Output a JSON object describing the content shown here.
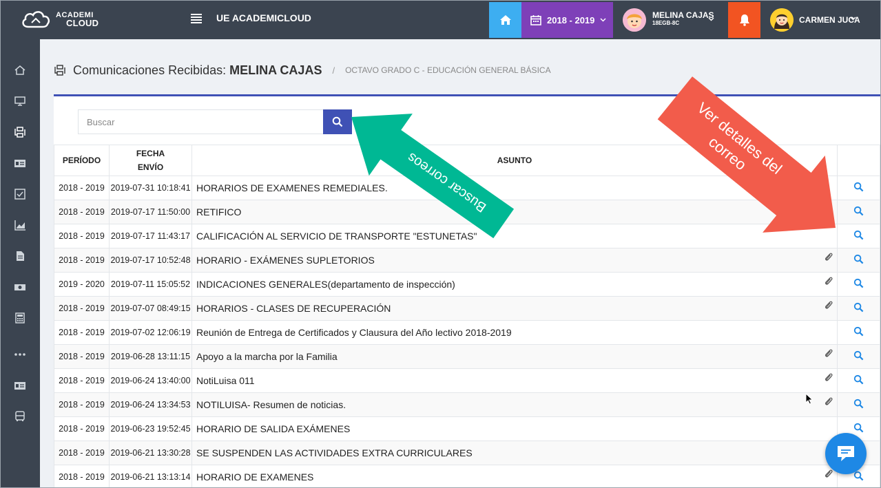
{
  "topbar": {
    "logo_line1": "ACADEMI",
    "logo_line2": "CLOUD",
    "app_title": "UE ACADEMICLOUD",
    "school_year": "2018 - 2019",
    "student_name": "MELINA CAJAS",
    "student_course": "18EGB-8C",
    "user_name": "CARMEN JUCA"
  },
  "colors": {
    "topbar": "#3b4450",
    "home": "#3daef1",
    "year": "#7e40b8",
    "alert": "#f25422",
    "primary": "#3f51b5",
    "annot_green": "#00b894",
    "annot_red": "#f25c4b",
    "link_icon": "#1e88e5"
  },
  "sidebar": {
    "icons": [
      "home-icon",
      "monitor-icon",
      "inbox-exchange-icon",
      "id-card-icon",
      "checklist-icon",
      "chart-icon",
      "document-icon",
      "money-icon",
      "calculator-icon",
      "more-icon",
      "id-card-icon",
      "bus-icon"
    ]
  },
  "page": {
    "title_prefix": "Comunicaciones Recibidas:",
    "title_name": "MELINA CAJAS",
    "separator": "/",
    "breadcrumb": "OCTAVO GRADO C - EDUCACIÓN GENERAL BÁSICA"
  },
  "search": {
    "placeholder": "Buscar"
  },
  "table": {
    "headers": {
      "period": "PERÍODO",
      "date_line1": "FECHA",
      "date_line2": "ENVÍO",
      "subject": "ASUNTO"
    },
    "rows": [
      {
        "period": "2018 - 2019",
        "date": "2019-07-31 10:18:41",
        "subject": "HORARIOS DE EXAMENES REMEDIALES.",
        "attachment": false
      },
      {
        "period": "2018 - 2019",
        "date": "2019-07-17 11:50:00",
        "subject": "RETIFICO",
        "attachment": false
      },
      {
        "period": "2018 - 2019",
        "date": "2019-07-17 11:43:17",
        "subject": "CALIFICACIÓN AL SERVICIO DE TRANSPORTE \"ESTUNETAS\"",
        "attachment": false
      },
      {
        "period": "2018 - 2019",
        "date": "2019-07-17 10:52:48",
        "subject": "HORARIO - EXÁMENES SUPLETORIOS",
        "attachment": true
      },
      {
        "period": "2019 - 2020",
        "date": "2019-07-11 15:05:52",
        "subject": "INDICACIONES GENERALES(departamento de inspección)",
        "attachment": true
      },
      {
        "period": "2018 - 2019",
        "date": "2019-07-07 08:49:15",
        "subject": "HORARIOS - CLASES DE RECUPERACIÓN",
        "attachment": true
      },
      {
        "period": "2018 - 2019",
        "date": "2019-07-02 12:06:19",
        "subject": "Reunión de Entrega de Certificados y Clausura del Año lectivo 2018-2019",
        "attachment": false
      },
      {
        "period": "2018 - 2019",
        "date": "2019-06-28 13:11:15",
        "subject": "Apoyo a la marcha por la Familia",
        "attachment": true
      },
      {
        "period": "2018 - 2019",
        "date": "2019-06-24 13:40:00",
        "subject": "NotiLuisa 011",
        "attachment": true
      },
      {
        "period": "2018 - 2019",
        "date": "2019-06-24 13:34:53",
        "subject": "NOTILUISA- Resumen de noticias.",
        "attachment": true
      },
      {
        "period": "2018 - 2019",
        "date": "2019-06-23 19:52:45",
        "subject": "HORARIO DE SALIDA EXÁMENES",
        "attachment": false
      },
      {
        "period": "2018 - 2019",
        "date": "2019-06-21 13:30:28",
        "subject": "SE SUSPENDEN LAS ACTIVIDADES EXTRA CURRICULARES",
        "attachment": false
      },
      {
        "period": "2018 - 2019",
        "date": "2019-06-21 13:13:14",
        "subject": "HORARIO DE EXAMENES",
        "attachment": true
      }
    ]
  },
  "annotations": {
    "search_arrow": "Buscar correos",
    "details_arrow_line1": "Ver detalles del",
    "details_arrow_line2": "correo"
  }
}
